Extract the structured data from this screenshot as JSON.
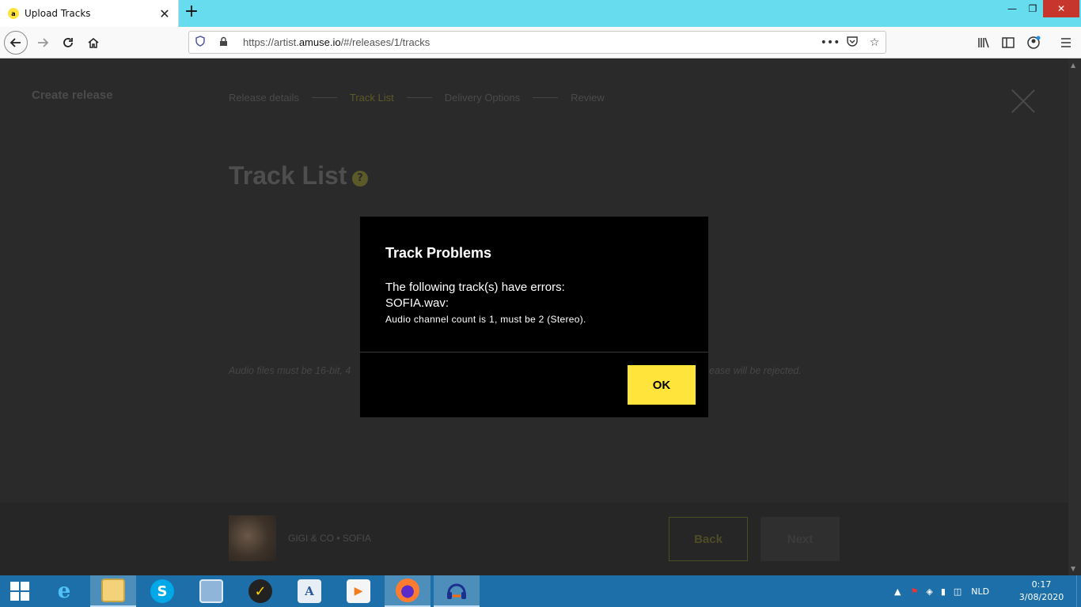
{
  "browser": {
    "tab_title": "Upload Tracks",
    "tab_favicon": "a",
    "url_prefix": "https://artist.",
    "url_domain": "amuse.io",
    "url_suffix": "/#/releases/1/tracks"
  },
  "page": {
    "create_release": "Create release",
    "steps": [
      "Release details",
      "Track List",
      "Delivery Options",
      "Review"
    ],
    "active_step": "Track List",
    "title": "Track List",
    "help_symbol": "?",
    "hint_left": "Audio files must be 16-bit, 4",
    "hint_right": "ease will be rejected."
  },
  "footer": {
    "artist_track": "GIGI & CO • SOFIA",
    "back_label": "Back",
    "next_label": "Next"
  },
  "modal": {
    "title": "Track Problems",
    "line1": "The following track(s) have errors:",
    "file": "SOFIA.wav:",
    "error": "Audio channel count is 1, must be 2 (Stereo).",
    "ok_label": "OK"
  },
  "taskbar": {
    "apps": [
      "internet-explorer-icon",
      "file-explorer-icon",
      "skype-icon",
      "control-panel-icon",
      "norton-icon",
      "word-icon",
      "media-player-icon",
      "firefox-icon",
      "headphones-app-icon"
    ],
    "language": "NLD",
    "time": "0:17",
    "date": "3/08/2020"
  },
  "colors": {
    "accent": "#ffe53b",
    "tabbar": "#68dcef",
    "taskbar": "#1c6fa8",
    "modal_bg": "#000000",
    "page_bg": "#2a2a2a"
  }
}
